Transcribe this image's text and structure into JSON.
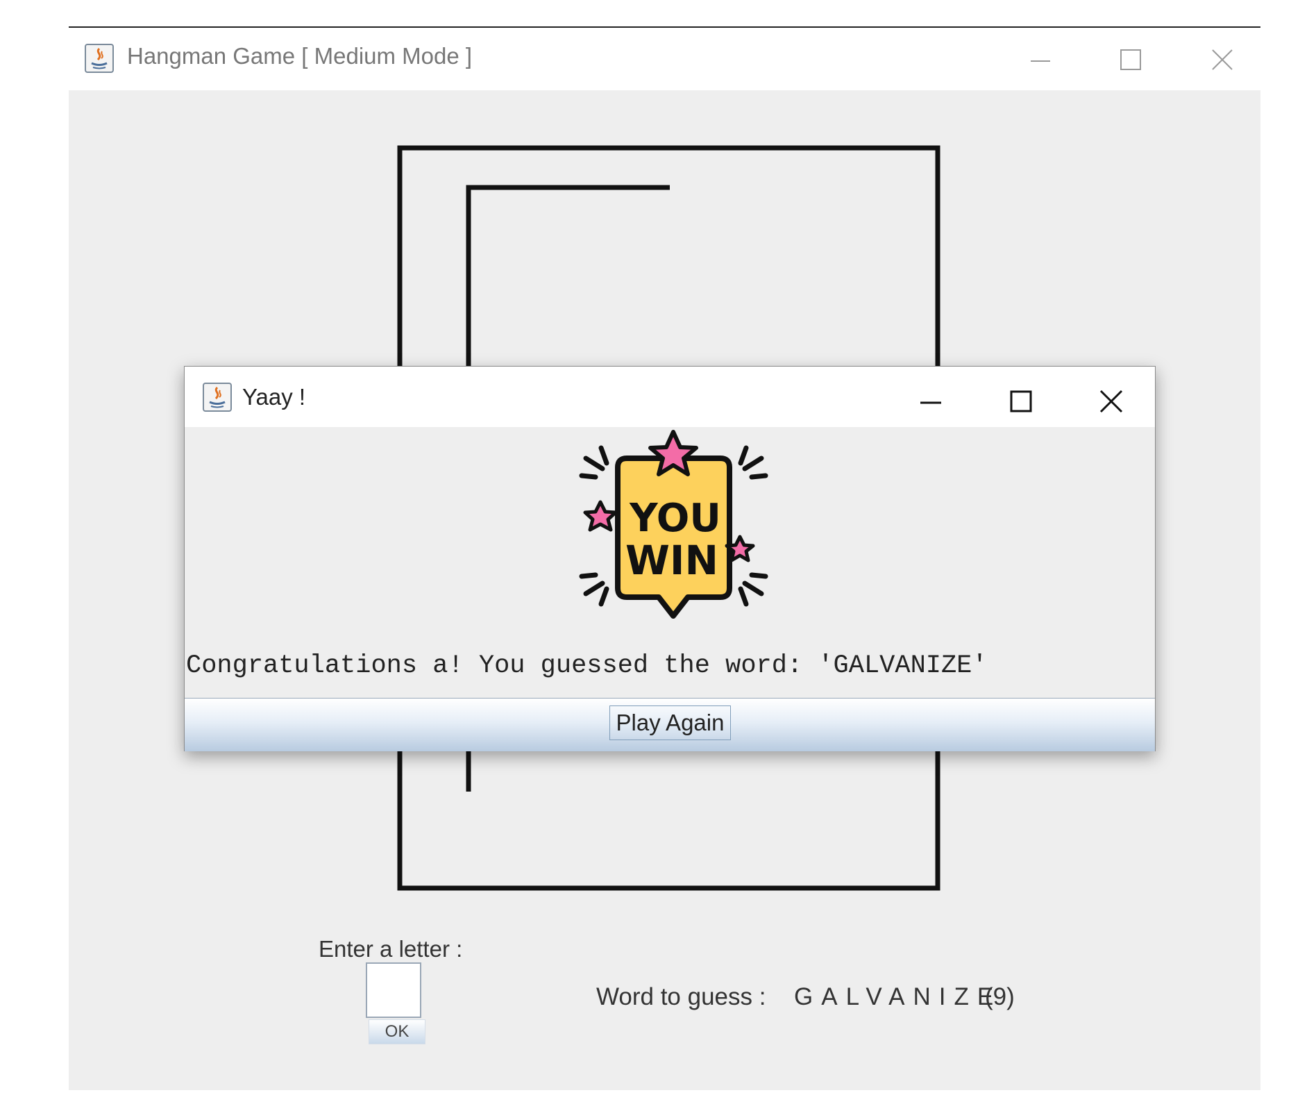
{
  "main_window": {
    "title": "Hangman Game [ Medium Mode ]",
    "icon": "java-app-icon"
  },
  "dialog": {
    "title": "Yaay !",
    "icon": "java-app-icon",
    "badge": {
      "icon": "you-win-badge",
      "line1": "YOU",
      "line2": "WIN"
    },
    "message": "Congratulations a! You guessed the word: 'GALVANIZE'",
    "play_again_label": "Play Again"
  },
  "input_panel": {
    "letter_label": "Enter a letter :",
    "letter_value": "",
    "ok_label": "OK"
  },
  "word_panel": {
    "label": "Word to guess :",
    "word": "GALVANIZE",
    "count": "(9)"
  },
  "colors": {
    "panel_background": "#eeeeee",
    "badge_yellow": "#fdd15c",
    "star_pink": "#f36ca7",
    "button_gradient_end": "#b8cbe0"
  }
}
